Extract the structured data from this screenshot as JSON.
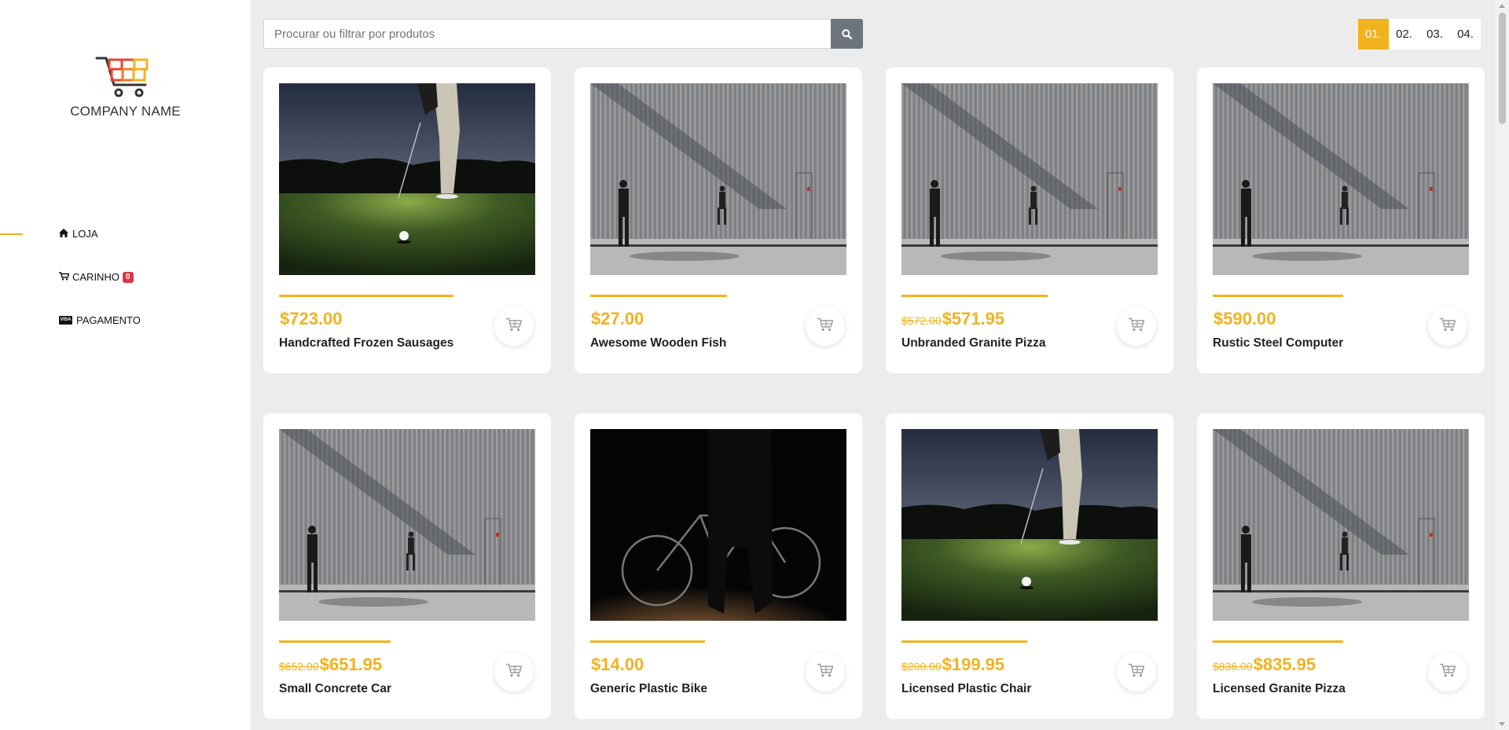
{
  "sidebar": {
    "company_name": "COMPANY NAME",
    "nav": [
      {
        "label": "LOJA",
        "icon": "home-icon",
        "active": true
      },
      {
        "label": "CARINHO",
        "icon": "cart-icon",
        "badge": "0"
      },
      {
        "label": "PAGAMENTO",
        "icon": "visa-card-icon"
      }
    ]
  },
  "search": {
    "placeholder": "Procurar ou filtrar por produtos",
    "button_icon": "search-icon"
  },
  "pagination": {
    "pages": [
      "01.",
      "02.",
      "03.",
      "04."
    ],
    "active": "01."
  },
  "colors": {
    "accent": "#f2b21e",
    "badge": "#dc3545",
    "search_button": "#6c757d",
    "background": "#ececec"
  },
  "products": [
    {
      "name": "Handcrafted Frozen Sausages",
      "price": "$723.00",
      "old_price": "",
      "image": "golf-photo"
    },
    {
      "name": "Awesome Wooden Fish",
      "price": "$27.00",
      "old_price": "",
      "image": "wall-walkers-photo"
    },
    {
      "name": "Unbranded Granite Pizza",
      "price": "$571.95",
      "old_price": "$572.00",
      "image": "wall-walkers-photo"
    },
    {
      "name": "Rustic Steel Computer",
      "price": "$590.00",
      "old_price": "",
      "image": "wall-walkers-photo"
    },
    {
      "name": "Small Concrete Car",
      "price": "$651.95",
      "old_price": "$652.00",
      "image": "wall-walkers-photo"
    },
    {
      "name": "Generic Plastic Bike",
      "price": "$14.00",
      "old_price": "",
      "image": "bicycle-photo"
    },
    {
      "name": "Licensed Plastic Chair",
      "price": "$199.95",
      "old_price": "$200.00",
      "image": "golf-photo"
    },
    {
      "name": "Licensed Granite Pizza",
      "price": "$835.95",
      "old_price": "$836.00",
      "image": "wall-walkers-photo"
    }
  ]
}
